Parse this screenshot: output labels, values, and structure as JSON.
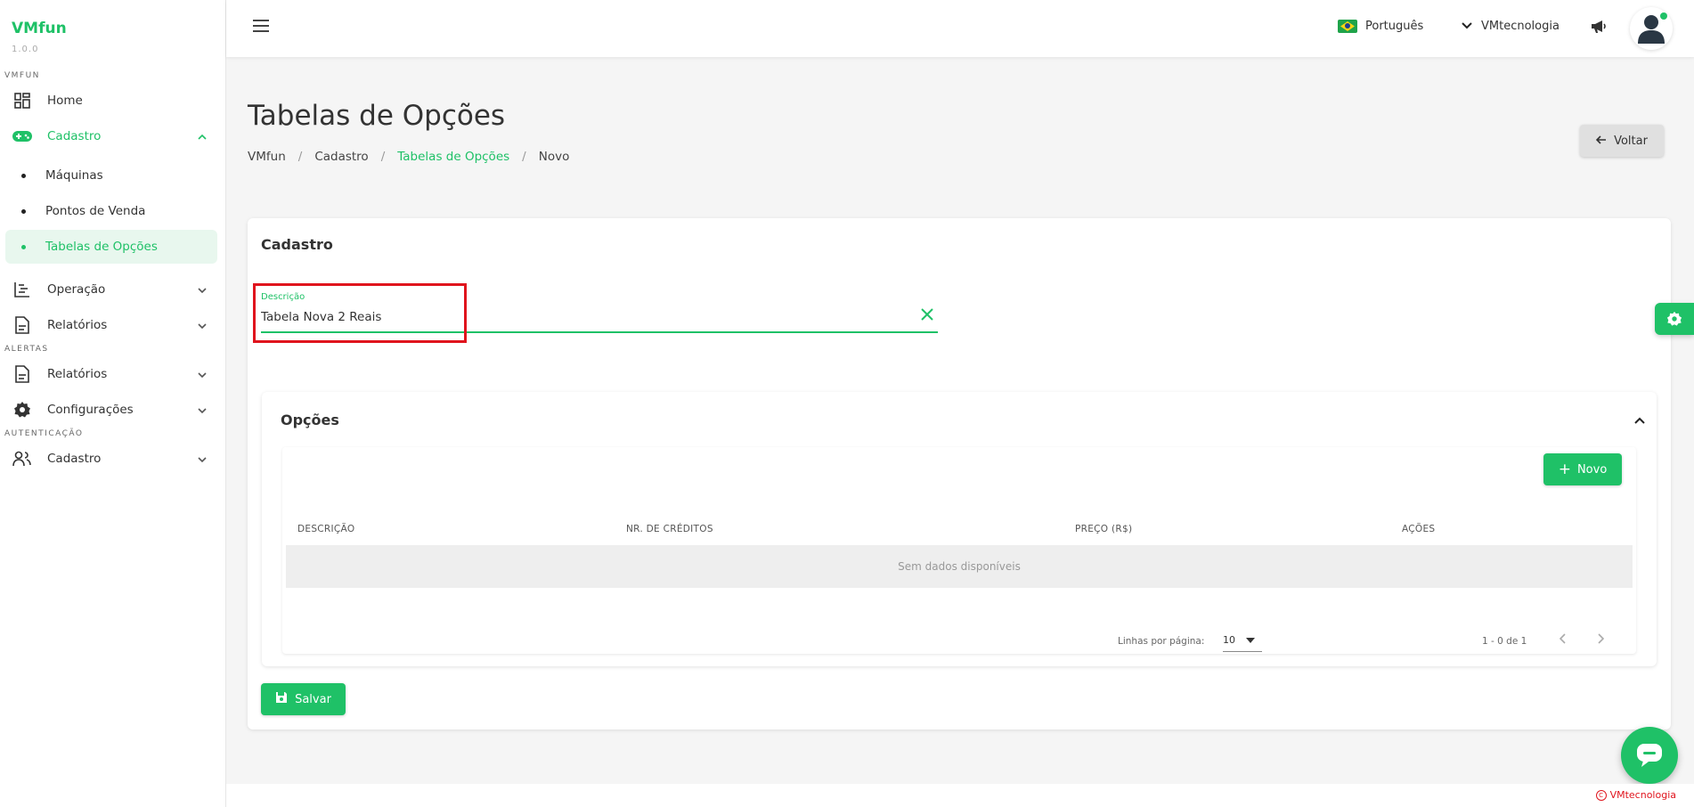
{
  "sidebar": {
    "brand": "VMfun",
    "version": "1.0.0",
    "sections": {
      "vmfun": "VMFUN",
      "alertas": "ALERTAS",
      "autenticacao": "AUTENTICAÇÃO"
    },
    "home": "Home",
    "cadastro": "Cadastro",
    "maquinas": "Máquinas",
    "pontos_venda": "Pontos de Venda",
    "tabelas_opcoes": "Tabelas de Opções",
    "operacao": "Operação",
    "relatorios": "Relatórios",
    "relatorios_alertas": "Relatórios",
    "configuracoes": "Configurações",
    "cadastro_auth": "Cadastro"
  },
  "header": {
    "language": "Português",
    "account": "VMtecnologia"
  },
  "page": {
    "title": "Tabelas de Opções",
    "breadcrumb": [
      "VMfun",
      "Cadastro",
      "Tabelas de Opções",
      "Novo"
    ],
    "back_label": "Voltar"
  },
  "form": {
    "title": "Cadastro",
    "descricao_label": "Descrição",
    "descricao_value": "Tabela Nova 2 Reais"
  },
  "options": {
    "title": "Opções",
    "new_label": "Novo",
    "columns": [
      "DESCRIÇÃO",
      "NR. DE CRÉDITOS",
      "PREÇO (R$)",
      "AÇÕES"
    ],
    "empty_text": "Sem dados disponíveis",
    "rows_per_page_label": "Linhas por página:",
    "rows_per_page_value": "10",
    "range_text": "1 - 0 de 1"
  },
  "save_label": "Salvar",
  "footer_brand": "VMtecnologia",
  "colors": {
    "accent": "#1fc167",
    "highlight": "#e0141d"
  }
}
